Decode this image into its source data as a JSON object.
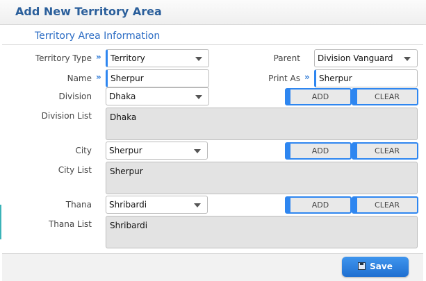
{
  "header": {
    "title": "Add New Territory Area"
  },
  "section": {
    "title": "Territory Area Information"
  },
  "arrow_glyph": "»",
  "form": {
    "territory_type": {
      "label": "Territory Type",
      "value": "Territory"
    },
    "parent": {
      "label": "Parent",
      "value": "Division Vanguard"
    },
    "name": {
      "label": "Name",
      "value": "Sherpur"
    },
    "print_as": {
      "label": "Print As",
      "value": "Sherpur"
    },
    "division": {
      "label": "Division",
      "value": "Dhaka",
      "list_label": "Division List",
      "list": [
        "Dhaka"
      ]
    },
    "city": {
      "label": "City",
      "value": "Sherpur",
      "list_label": "City List",
      "list": [
        "Sherpur"
      ]
    },
    "thana": {
      "label": "Thana",
      "value": "Shribardi",
      "list_label": "Thana List",
      "list": [
        "Shribardi"
      ]
    }
  },
  "buttons": {
    "add": "ADD",
    "clear": "CLEAR",
    "save": "Save"
  },
  "colors": {
    "accent": "#2e86f0",
    "title": "#2b5f9b",
    "section_title": "#2b6cc4"
  },
  "icons": {
    "save": "floppy-disk-icon",
    "dropdown": "chevron-down-icon",
    "required": "double-chevron-right-icon"
  }
}
